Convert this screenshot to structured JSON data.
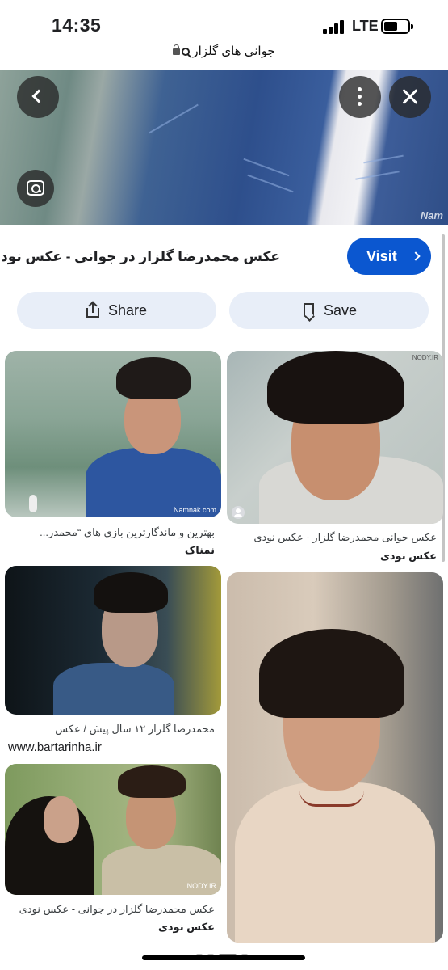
{
  "status": {
    "time": "14:35",
    "network": "LTE"
  },
  "url": {
    "query": "جوانی های گلزار"
  },
  "hero": {
    "watermark": "Nam",
    "icons": {
      "back": "chevron-left-icon",
      "menu": "more-vert-icon",
      "close": "close-icon",
      "lens": "lens-icon"
    }
  },
  "result": {
    "title": "عکس محمدرضا گلزار در جوانی - عکس نودی",
    "visit_label": "Visit",
    "share_label": "Share",
    "save_label": "Save"
  },
  "grid": {
    "left": [
      {
        "caption": "بهترین و ماندگارترین بازی های “محمدر...",
        "source": "نمناک",
        "watermark": "Namnak.com"
      },
      {
        "caption": "محمدرضا گلزار ۱۲ سال پیش / عکس",
        "source": "www.bartarinha.ir"
      },
      {
        "caption": "عکس محمدرضا گلزار در جوانی - عکس نودی",
        "source": "عکس نودی",
        "watermark": "NODY.IR"
      }
    ],
    "right": [
      {
        "caption": "عکس جوانی محمدرضا گلزار - عکس نودی",
        "source": "عکس نودی",
        "watermark": "NODY.IR"
      },
      {
        "caption": "",
        "source": ""
      }
    ]
  }
}
